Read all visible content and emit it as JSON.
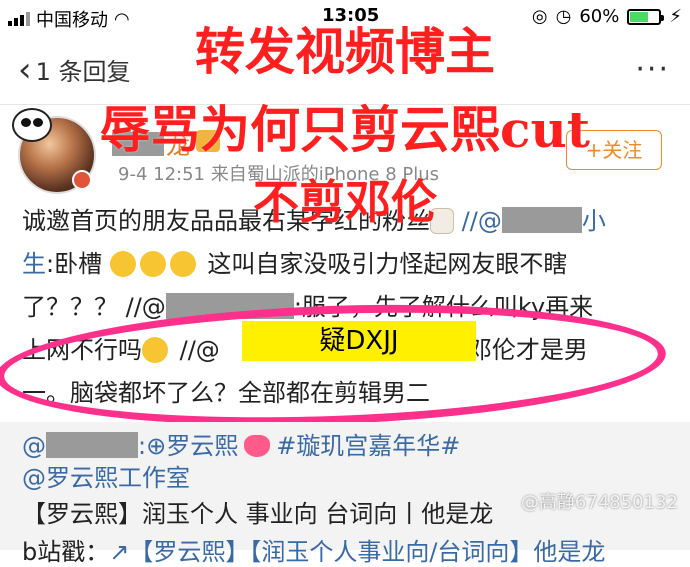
{
  "status_bar": {
    "carrier": "中国移动",
    "time": "13:05",
    "battery_text": "60%",
    "battery_level": 0.6
  },
  "nav": {
    "back_label": "1 条回复",
    "more": "···"
  },
  "post": {
    "user_suffix": "龙",
    "meta": "9-4 12:51  来自蜀山派的iPhone 8 Plus",
    "follow_label": "+关注",
    "line1": "诚邀首页的朋友品品最右某字红的粉丝",
    "line1_tail": "小",
    "line2_prefix": "生",
    "line2_mid": ":卧槽",
    "line2_text": " 这叫自家没吸引力怪起网友眼不瞎",
    "line3_a": "了？？？ //@",
    "line3_b": ":服了",
    "line3_c": "，先了解什么叫ky再来",
    "line4_a": "上网不行吗",
    "line4_b": " //@",
    "line4_c": ":邓伦才是男",
    "highlight": "疑DXJJ",
    "line5": "一。脑袋都坏了么？全部都在剪辑男二"
  },
  "repost": {
    "line1_at": "@",
    "line1_a": ":",
    "line1_name": "⊕罗云熙",
    "line1_tag": "#璇玑宫嘉年华#",
    "line2": "@罗云熙工作室",
    "line3": "【罗云熙】润玉个人 事业向 台词向丨他是龙",
    "line4_a": "b站戳：",
    "line4_b": "【罗云熙】【润玉个人事业向/台词向】他是龙"
  },
  "overlay": {
    "line1": "转发视频博主",
    "line2": "辱骂为何只剪云熙cut",
    "line3": "不剪邓伦"
  },
  "watermark": "@高静674850132",
  "colors": {
    "overlay_red": "#ff1f1f",
    "circle_pink": "#ff2f8c",
    "highlight_yellow": "#fff000",
    "link_blue": "#3a6aa6",
    "follow_orange": "#f08a24"
  }
}
